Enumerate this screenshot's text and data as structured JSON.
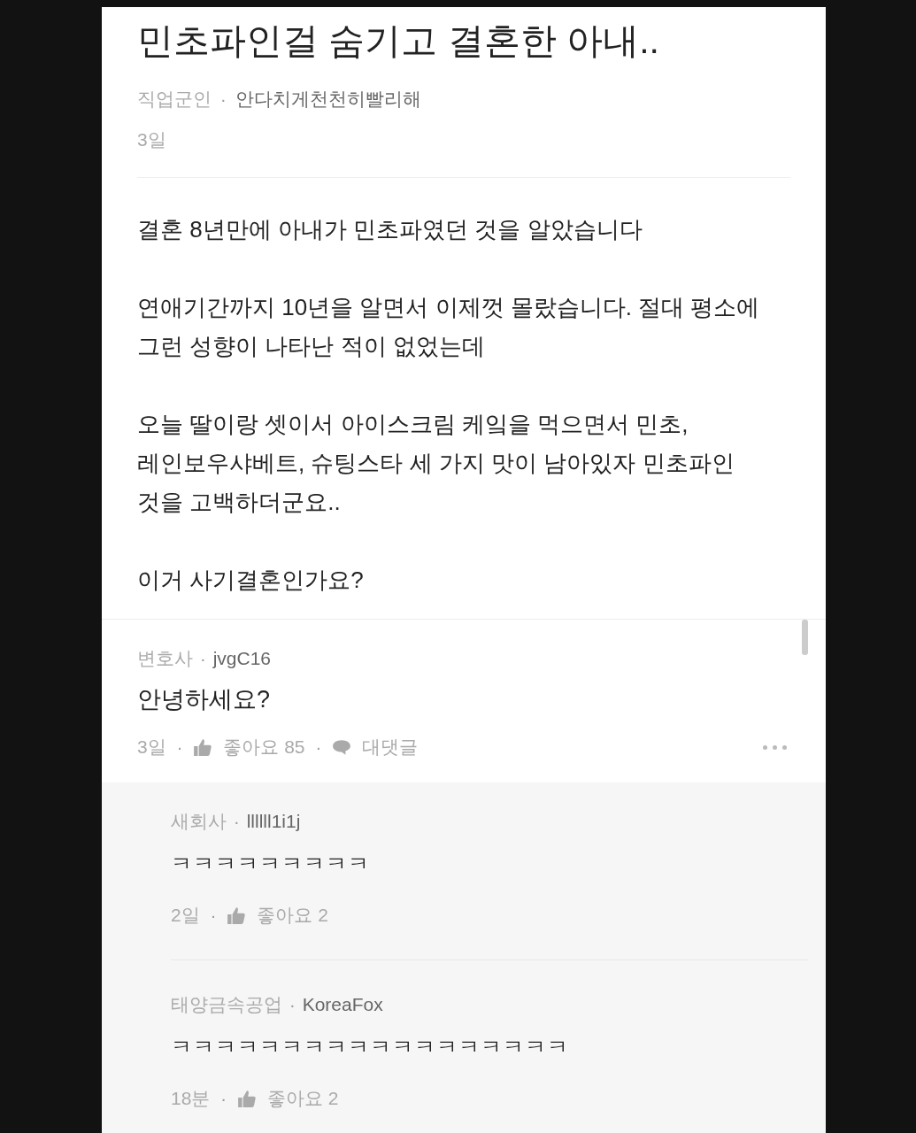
{
  "post": {
    "title": "민초파인걸 숨기고 결혼한 아내..",
    "company": "직업군인",
    "separator": "·",
    "author": "안다치게천천히빨리해",
    "time": "3일",
    "paragraphs": [
      [
        "결혼 8년만에 아내가 민초파였던 것을 알았습니다"
      ],
      [
        "연애기간까지 10년을 알면서 이제껏 몰랐습니다. 절대 평소에",
        "그런 성향이 나타난 적이 없었는데"
      ],
      [
        "오늘 딸이랑 셋이서 아이스크림 케잌을 먹으면서 민초,",
        "레인보우샤베트, 슈팅스타 세 가지 맛이 남아있자 민초파인",
        "것을 고백하더군요.."
      ],
      [
        "이거 사기결혼인가요?"
      ]
    ]
  },
  "comment": {
    "company": "변호사",
    "separators": [
      "·",
      "·",
      "·"
    ],
    "author": "jvgC16",
    "text": "안녕하세요?",
    "time": "3일",
    "likes": "좋아요 85",
    "reply": "대댓글"
  },
  "replies": [
    {
      "company": "새회사",
      "separators": [
        "·",
        "·"
      ],
      "author": "llllll1i1j",
      "text": "ㅋㅋㅋㅋㅋㅋㅋㅋㅋ",
      "time": "2일",
      "likes": "좋아요 2"
    },
    {
      "company": "태양금속공업",
      "separators": [
        "·",
        "·"
      ],
      "author": "KoreaFox",
      "text": "ㅋㅋㅋㅋㅋㅋㅋㅋㅋㅋㅋㅋㅋㅋㅋㅋㅋㅋ",
      "time": "18분",
      "likes": "좋아요 2"
    }
  ]
}
